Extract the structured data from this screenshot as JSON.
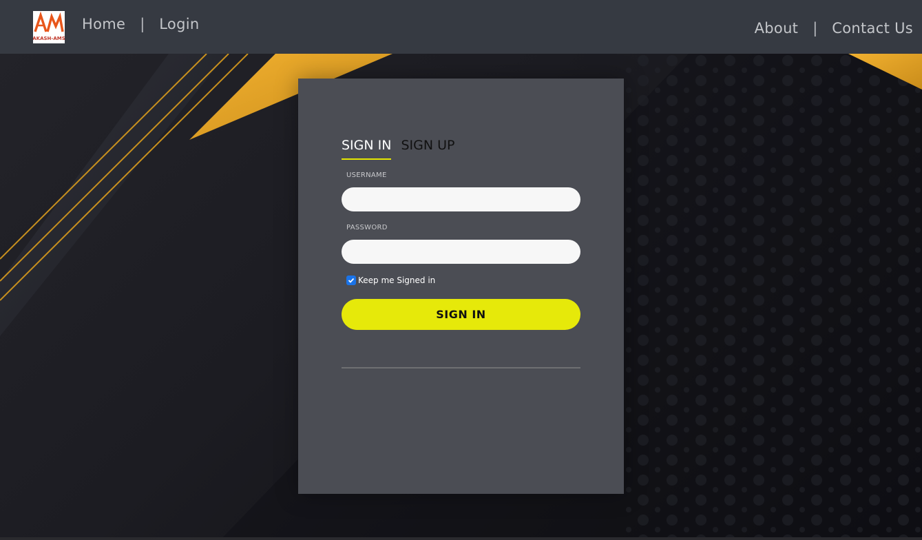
{
  "header": {
    "logo_text": "AKASH-AMS",
    "nav_left": [
      {
        "label": "Home"
      },
      {
        "label": "Login"
      }
    ],
    "nav_right": [
      {
        "label": "About"
      },
      {
        "label": "Contact Us"
      }
    ],
    "separator": "|"
  },
  "auth": {
    "tabs": [
      {
        "label": "SIGN IN",
        "active": true
      },
      {
        "label": "SIGN UP",
        "active": false
      }
    ],
    "username": {
      "label": "USERNAME",
      "value": "",
      "placeholder": ""
    },
    "password": {
      "label": "PASSWORD",
      "value": "",
      "placeholder": ""
    },
    "remember": {
      "label": "Keep me Signed in",
      "checked": true
    },
    "submit_label": "SIGN IN"
  },
  "colors": {
    "header_bg": "#363a42",
    "card_bg": "#4b4d54",
    "accent_yellow": "#e6e90a",
    "stripe_orange": "#e8a321",
    "checkbox_blue": "#1a73e8"
  }
}
